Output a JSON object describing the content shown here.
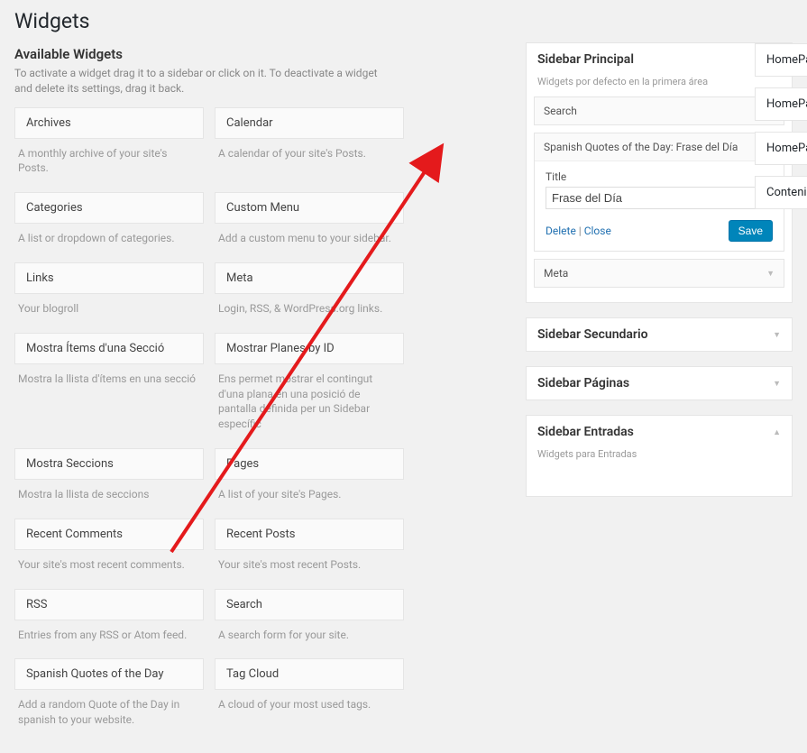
{
  "page": {
    "title": "Widgets"
  },
  "available": {
    "heading": "Available Widgets",
    "desc": "To activate a widget drag it to a sidebar or click on it. To deactivate a widget and delete its settings, drag it back.",
    "items": [
      {
        "title": "Archives",
        "desc": "A monthly archive of your site's Posts."
      },
      {
        "title": "Calendar",
        "desc": "A calendar of your site's Posts."
      },
      {
        "title": "Categories",
        "desc": "A list or dropdown of categories."
      },
      {
        "title": "Custom Menu",
        "desc": "Add a custom menu to your sidebar."
      },
      {
        "title": "Links",
        "desc": "Your blogroll"
      },
      {
        "title": "Meta",
        "desc": "Login, RSS, & WordPress.org links."
      },
      {
        "title": "Mostra Ítems d'una Secció",
        "desc": "Mostra la llista d'ítems en una secció"
      },
      {
        "title": "Mostrar Planes by ID",
        "desc": "Ens permet mostrar el contingut d'una plana en una posició de pantalla definida per un Sidebar específic"
      },
      {
        "title": "Mostra Seccions",
        "desc": "Mostra la llista de seccions"
      },
      {
        "title": "Pages",
        "desc": "A list of your site's Pages."
      },
      {
        "title": "Recent Comments",
        "desc": "Your site's most recent comments."
      },
      {
        "title": "Recent Posts",
        "desc": "Your site's most recent Posts."
      },
      {
        "title": "RSS",
        "desc": "Entries from any RSS or Atom feed."
      },
      {
        "title": "Search",
        "desc": "A search form for your site."
      },
      {
        "title": "Spanish Quotes of the Day",
        "desc": "Add a random Quote of the Day in spanish to your website."
      },
      {
        "title": "Tag Cloud",
        "desc": "A cloud of your most used tags."
      }
    ]
  },
  "sidebars": {
    "principal": {
      "title": "Sidebar Principal",
      "desc": "Widgets por defecto en la primera área",
      "widgets": {
        "search": {
          "label": "Search"
        },
        "spanish": {
          "label_name": "Spanish Quotes of the Day",
          "label_value": ": Frase del Día",
          "title_label": "Title",
          "title_value": "Frase del Día",
          "delete": "Delete",
          "close": "Close",
          "save": "Save"
        },
        "meta": {
          "label": "Meta"
        }
      }
    },
    "secundario": {
      "title": "Sidebar Secundario"
    },
    "paginas": {
      "title": "Sidebar Páginas"
    },
    "entradas": {
      "title": "Sidebar Entradas",
      "desc": "Widgets para Entradas"
    }
  },
  "tabs": [
    {
      "label": "HomePage"
    },
    {
      "label": "HomePage"
    },
    {
      "label": "HomePage"
    },
    {
      "label": "Contenido"
    }
  ]
}
